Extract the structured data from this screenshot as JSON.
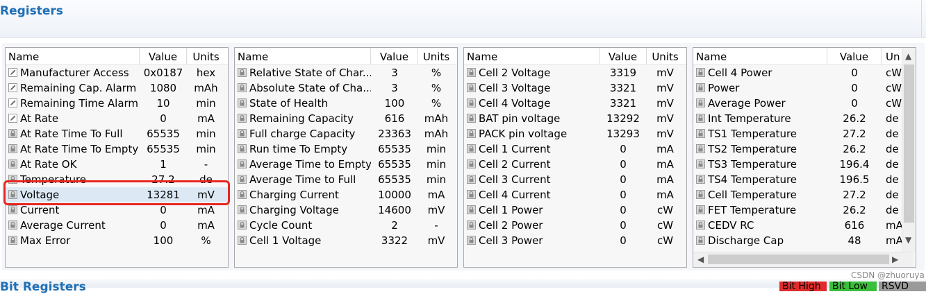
{
  "header": {
    "title": "Registers"
  },
  "column_headers": {
    "name": "Name",
    "value": "Value",
    "units": "Units"
  },
  "panes": [
    {
      "rows": [
        {
          "name": "Manufacturer Access",
          "value": "0x0187",
          "units": "hex",
          "icon": "edit-icon"
        },
        {
          "name": "Remaining Cap. Alarm",
          "value": "1080",
          "units": "mAh",
          "icon": "edit-icon"
        },
        {
          "name": "Remaining Time Alarm",
          "value": "10",
          "units": "min",
          "icon": "edit-icon"
        },
        {
          "name": "At Rate",
          "value": "0",
          "units": "mA",
          "icon": "edit-icon"
        },
        {
          "name": "At Rate Time To Full",
          "value": "65535",
          "units": "min",
          "icon": "lock-icon"
        },
        {
          "name": "At Rate Time To Empty",
          "value": "65535",
          "units": "min",
          "icon": "lock-icon"
        },
        {
          "name": "At Rate OK",
          "value": "1",
          "units": "-",
          "icon": "lock-icon"
        },
        {
          "name": "Temperature",
          "value": "27.2",
          "units": "de",
          "icon": "lock-icon"
        },
        {
          "name": "Voltage",
          "value": "13281",
          "units": "mV",
          "icon": "lock-icon"
        },
        {
          "name": "Current",
          "value": "0",
          "units": "mA",
          "icon": "lock-icon"
        },
        {
          "name": "Average Current",
          "value": "0",
          "units": "mA",
          "icon": "lock-icon"
        },
        {
          "name": "Max Error",
          "value": "100",
          "units": "%",
          "icon": "lock-icon"
        }
      ]
    },
    {
      "rows": [
        {
          "name": "Relative State of Char...",
          "value": "3",
          "units": "%",
          "icon": "lock-icon"
        },
        {
          "name": "Absolute State of Cha...",
          "value": "3",
          "units": "%",
          "icon": "lock-icon"
        },
        {
          "name": "State of Health",
          "value": "100",
          "units": "%",
          "icon": "lock-icon"
        },
        {
          "name": "Remaining Capacity",
          "value": "616",
          "units": "mAh",
          "icon": "lock-icon"
        },
        {
          "name": "Full charge Capacity",
          "value": "23363",
          "units": "mAh",
          "icon": "lock-icon"
        },
        {
          "name": "Run time To Empty",
          "value": "65535",
          "units": "min",
          "icon": "lock-icon"
        },
        {
          "name": "Average Time to Empty",
          "value": "65535",
          "units": "min",
          "icon": "lock-icon"
        },
        {
          "name": "Average Time to Full",
          "value": "65535",
          "units": "min",
          "icon": "lock-icon"
        },
        {
          "name": "Charging Current",
          "value": "10000",
          "units": "mA",
          "icon": "lock-icon"
        },
        {
          "name": "Charging Voltage",
          "value": "14600",
          "units": "mV",
          "icon": "lock-icon"
        },
        {
          "name": "Cycle Count",
          "value": "2",
          "units": "-",
          "icon": "lock-icon"
        },
        {
          "name": "Cell 1 Voltage",
          "value": "3322",
          "units": "mV",
          "icon": "lock-icon"
        }
      ]
    },
    {
      "rows": [
        {
          "name": "Cell 2 Voltage",
          "value": "3319",
          "units": "mV",
          "icon": "lock-icon"
        },
        {
          "name": "Cell 3 Voltage",
          "value": "3321",
          "units": "mV",
          "icon": "lock-icon"
        },
        {
          "name": "Cell 4 Voltage",
          "value": "3321",
          "units": "mV",
          "icon": "lock-icon"
        },
        {
          "name": "BAT pin voltage",
          "value": "13292",
          "units": "mV",
          "icon": "lock-icon"
        },
        {
          "name": "PACK pin voltage",
          "value": "13293",
          "units": "mV",
          "icon": "lock-icon"
        },
        {
          "name": "Cell 1 Current",
          "value": "0",
          "units": "mA",
          "icon": "lock-icon"
        },
        {
          "name": "Cell 2 Current",
          "value": "0",
          "units": "mA",
          "icon": "lock-icon"
        },
        {
          "name": "Cell 3 Current",
          "value": "0",
          "units": "mA",
          "icon": "lock-icon"
        },
        {
          "name": "Cell 4 Current",
          "value": "0",
          "units": "mA",
          "icon": "lock-icon"
        },
        {
          "name": "Cell 1 Power",
          "value": "0",
          "units": "cW",
          "icon": "lock-icon"
        },
        {
          "name": "Cell 2 Power",
          "value": "0",
          "units": "cW",
          "icon": "lock-icon"
        },
        {
          "name": "Cell 3 Power",
          "value": "0",
          "units": "cW",
          "icon": "lock-icon"
        }
      ]
    },
    {
      "units_header": "Un",
      "rows": [
        {
          "name": "Cell 4 Power",
          "value": "0",
          "units": "cW",
          "icon": "lock-icon"
        },
        {
          "name": "Power",
          "value": "0",
          "units": "cW",
          "icon": "lock-icon"
        },
        {
          "name": "Average Power",
          "value": "0",
          "units": "cW",
          "icon": "lock-icon"
        },
        {
          "name": "Int Temperature",
          "value": "26.2",
          "units": "de",
          "icon": "lock-icon"
        },
        {
          "name": "TS1 Temperature",
          "value": "27.2",
          "units": "de",
          "icon": "lock-icon"
        },
        {
          "name": "TS2 Temperature",
          "value": "26.2",
          "units": "de",
          "icon": "lock-icon"
        },
        {
          "name": "TS3 Temperature",
          "value": "196.4",
          "units": "de",
          "icon": "lock-icon"
        },
        {
          "name": "TS4 Temperature",
          "value": "196.5",
          "units": "de",
          "icon": "lock-icon"
        },
        {
          "name": "Cell Temperature",
          "value": "27.2",
          "units": "de",
          "icon": "lock-icon"
        },
        {
          "name": "FET Temperature",
          "value": "26.2",
          "units": "de",
          "icon": "lock-icon"
        },
        {
          "name": "CEDV RC",
          "value": "616",
          "units": "mA",
          "icon": "lock-icon"
        },
        {
          "name": "Discharge Cap",
          "value": "48",
          "units": "mA",
          "icon": "lock-icon"
        }
      ]
    }
  ],
  "selected_row": {
    "pane": 0,
    "row": 8
  },
  "watermark": "CSDN @zhuoruya",
  "bottom": {
    "title": "Bit Registers",
    "flags": [
      {
        "label": "Bit High",
        "color": "#e02c2c"
      },
      {
        "label": "Bit Low",
        "color": "#3bbf3b"
      },
      {
        "label": "RSVD",
        "color": "#9a9a9a"
      }
    ]
  },
  "colors": {
    "title_blue": "#1f6fb5",
    "highlight_red": "#e8261f",
    "selected_row": "#dce9f5"
  }
}
